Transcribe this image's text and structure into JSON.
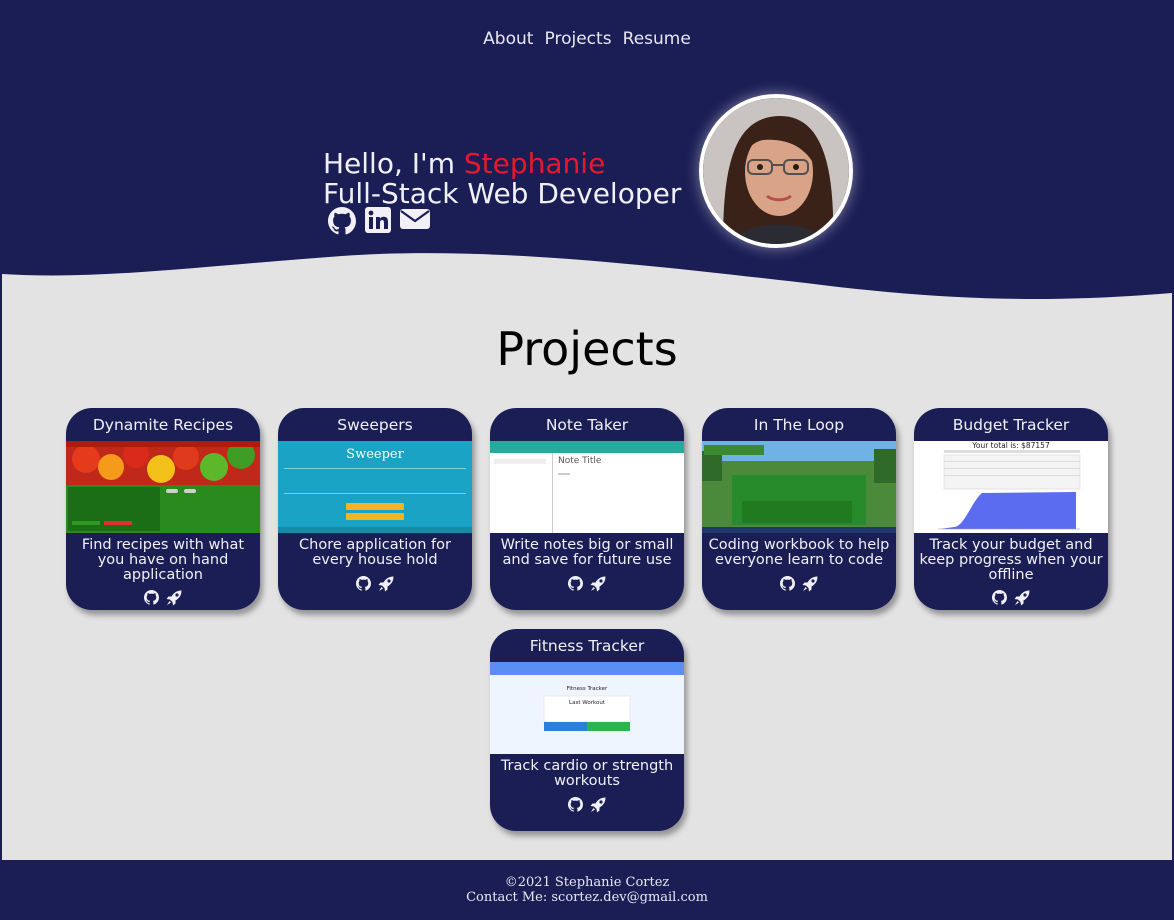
{
  "nav": {
    "items": [
      "About",
      "Projects",
      "Resume"
    ]
  },
  "hero": {
    "greeting": "Hello, I'm ",
    "name": "Stephanie",
    "role": "Full-Stack Web Developer",
    "social": [
      "github-icon",
      "linkedin-icon",
      "envelope-icon"
    ]
  },
  "projects": {
    "title": "Projects",
    "cards": [
      {
        "title": "Dynamite Recipes",
        "desc": "Find recipes with what you have on hand application",
        "links": [
          "github-icon",
          "rocket-icon"
        ]
      },
      {
        "title": "Sweepers",
        "desc": "Chore application for every house hold",
        "shot_title": "Sweeper",
        "links": [
          "github-icon",
          "rocket-icon"
        ]
      },
      {
        "title": "Note Taker",
        "desc": "Write notes big or small and save for future use",
        "shot_title": "Note Title",
        "links": [
          "github-icon",
          "rocket-icon"
        ]
      },
      {
        "title": "In The Loop",
        "desc": "Coding workbook to help everyone learn to code",
        "links": [
          "github-icon",
          "rocket-icon"
        ]
      },
      {
        "title": "Budget Tracker",
        "desc": "Track your budget and keep progress when your offline",
        "shot_title": "Your total is: $87157",
        "links": [
          "github-icon",
          "rocket-icon"
        ]
      },
      {
        "title": "Fitness Tracker",
        "desc": "Track cardio or strength workouts",
        "shot_title": "Fitness Tracker",
        "shot_sub": "Last Workout",
        "links": [
          "github-icon",
          "rocket-icon"
        ]
      }
    ]
  },
  "footer": {
    "copyright": "©2021 Stephanie Cortez",
    "contact": "Contact Me: scortez.dev@gmail.com"
  },
  "colors": {
    "navy": "#1b1e55",
    "accent": "#e8182b",
    "background": "#e3e3e3"
  }
}
